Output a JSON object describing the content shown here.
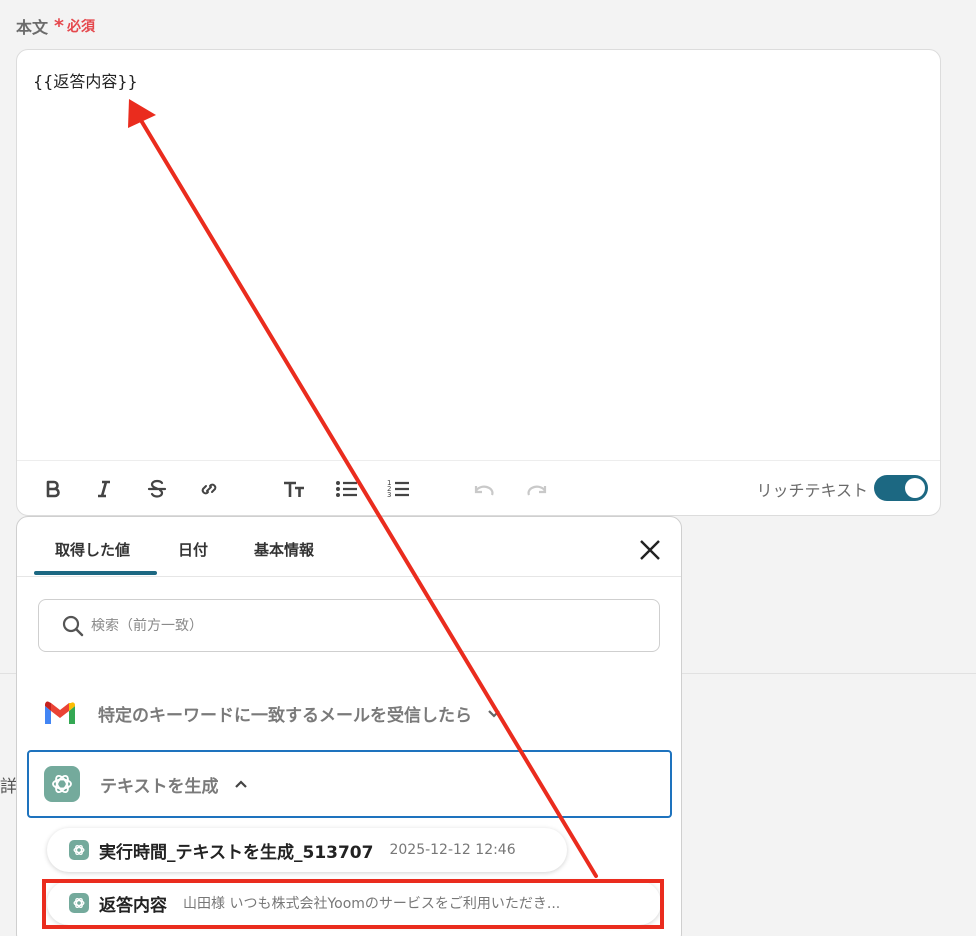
{
  "field": {
    "label": "本文",
    "required_mark": "*",
    "required_text": "必須"
  },
  "editor": {
    "content": "{{返答内容}}",
    "rich_text_label": "リッチテキスト",
    "rich_text_enabled": true
  },
  "side_text": "詳",
  "panel": {
    "tabs": [
      {
        "label": "取得した値",
        "active": true
      },
      {
        "label": "日付"
      },
      {
        "label": "基本情報"
      }
    ],
    "search": {
      "placeholder": "検索（前方一致）",
      "value": ""
    },
    "groups": [
      {
        "label": "特定のキーワードに一致するメールを受信したら",
        "icon": "gmail-icon",
        "expanded": false
      },
      {
        "label": "テキストを生成",
        "icon": "chatgpt-icon",
        "expanded": true
      }
    ],
    "items": [
      {
        "name": "実行時間_テキストを生成_513707",
        "value": "2025-12-12 12:46"
      },
      {
        "name": "返答内容",
        "value": "山田様 いつも株式会社Yoomのサービスをご利用いただき..."
      }
    ]
  },
  "colors": {
    "accent": "#1c6882",
    "required": "#e5484d",
    "annotation": "#ea2c1e",
    "selected_border": "#1e73be",
    "chatgpt": "#74aa9c"
  }
}
